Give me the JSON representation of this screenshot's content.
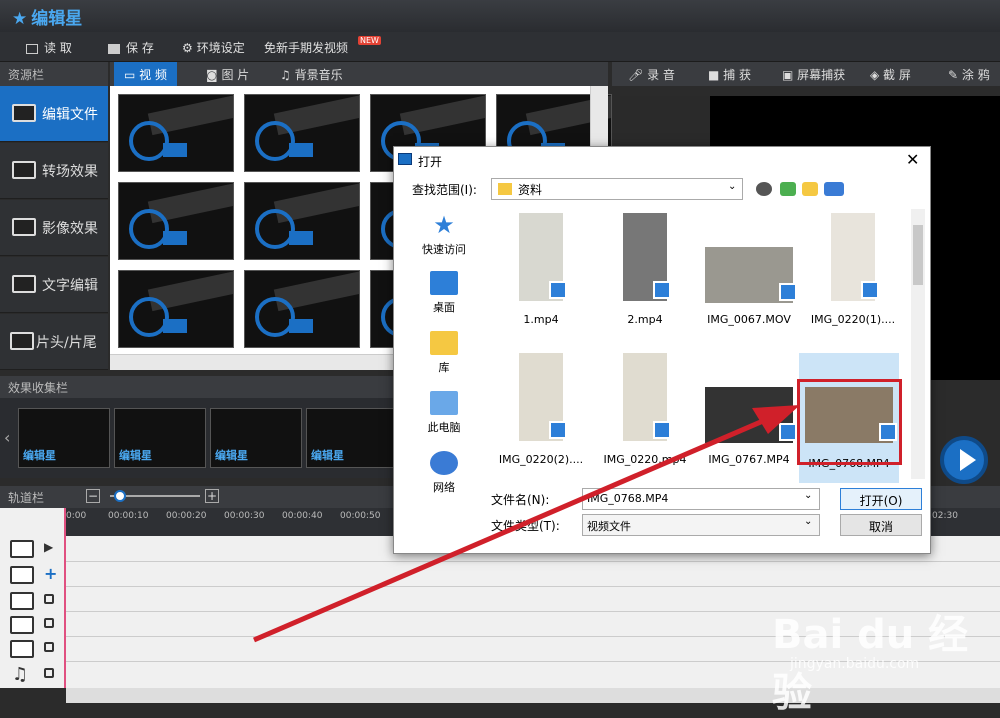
{
  "app": {
    "title": "编辑星"
  },
  "menu": {
    "open": "读 取",
    "save": "保 存",
    "settings": "环境设定",
    "free_video": "免新手期发视频",
    "new_badge": "NEW"
  },
  "sidebar": {
    "header": "资源栏",
    "items": [
      {
        "label": "编辑文件"
      },
      {
        "label": "转场效果"
      },
      {
        "label": "影像效果"
      },
      {
        "label": "文字编辑"
      },
      {
        "label": "片头/片尾"
      }
    ]
  },
  "tabs": [
    {
      "label": "视 频"
    },
    {
      "label": "图 片"
    },
    {
      "label": "背景音乐"
    }
  ],
  "right_toolbar": {
    "record": "录 音",
    "capture": "捕 获",
    "screen_capture": "屏幕捕获",
    "screenshot": "截 屏",
    "paint": "涂 鸦"
  },
  "effects": {
    "header": "效果收集栏",
    "items": [
      "编辑星",
      "编辑星",
      "编辑星",
      "编辑星"
    ]
  },
  "timeline": {
    "header": "轨道栏",
    "ticks": [
      "0:00",
      "00:00:10",
      "00:00:20",
      "00:00:30",
      "00:00:40",
      "00:00:50",
      "02:30"
    ]
  },
  "dialog": {
    "title": "打开",
    "lookin_label": "查找范围(I):",
    "lookin_value": "资料",
    "places": [
      "快速访问",
      "桌面",
      "库",
      "此电脑",
      "网络"
    ],
    "files": [
      {
        "name": "1.mp4"
      },
      {
        "name": "2.mp4"
      },
      {
        "name": "IMG_0067.MOV"
      },
      {
        "name": "IMG_0220(1)...."
      },
      {
        "name": "IMG_0220(2)...."
      },
      {
        "name": "IMG_0220.mp4"
      },
      {
        "name": "IMG_0767.MP4"
      },
      {
        "name": "IMG_0768.MP4"
      }
    ],
    "filename_label": "文件名(N):",
    "filename_value": "IMG_0768.MP4",
    "filetype_label": "文件类型(T):",
    "filetype_value": "视频文件",
    "open_button": "打开(O)",
    "cancel_button": "取消"
  },
  "watermark": {
    "text": "Bai du 经验",
    "sub": "jingyan.baidu.com"
  },
  "colors": {
    "accent": "#1b6fc4",
    "highlight": "#d0202a"
  }
}
